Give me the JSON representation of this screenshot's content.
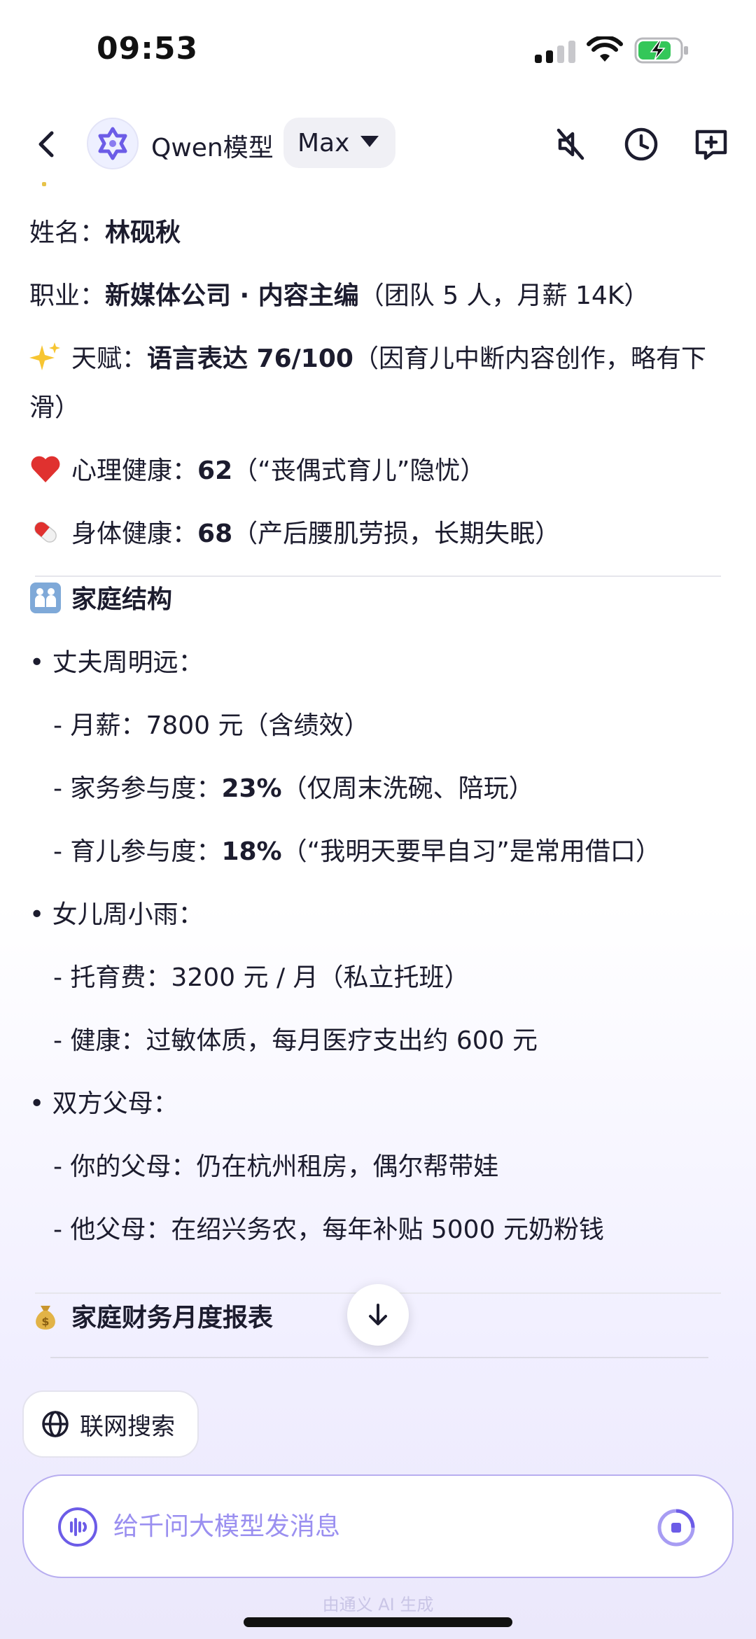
{
  "status_bar": {
    "time": "09:53",
    "battery_level": 0.75
  },
  "header": {
    "model_name": "Qwen模型",
    "model_variant": "Max"
  },
  "content": {
    "profile": [
      {
        "label": "姓名：",
        "value": "林砚秋",
        "note": ""
      },
      {
        "label": "职业：",
        "value": "新媒体公司 · 内容主编",
        "note": "（团队 5 人，月薪 14K）"
      },
      {
        "emoji": "sparkles-emoji",
        "label": "天赋：",
        "value": "语言表达 76/100",
        "note": "（因育儿中断内容创作，略有下",
        "note_cont": "滑）"
      },
      {
        "emoji": "red-heart-emoji",
        "label": "心理健康：",
        "value": "62",
        "note": "（“丧偶式育儿”隐忧）"
      },
      {
        "emoji": "pill-emoji",
        "label": "身体健康：",
        "value": "68",
        "note": "（产后腰肌劳损，长期失眠）"
      }
    ],
    "family_section": {
      "title": "家庭结构",
      "icon": "family-emoji",
      "husband": {
        "heading": "• 丈夫周明远：",
        "salary": {
          "label": "- 月薪：",
          "value": "7800 元",
          "note": "（含绩效）"
        },
        "housework": {
          "label": "- 家务参与度：",
          "value": "23%",
          "note": "（仅周末洗碗、陪玩）"
        },
        "childcare": {
          "label": "- 育儿参与度：",
          "value": "18%",
          "note": "（“我明天要早自习”是常用借口）"
        }
      },
      "daughter": {
        "heading": "• 女儿周小雨：",
        "fee": "- 托育费：3200 元 / 月（私立托班）",
        "health": "- 健康：过敏体质，每月医疗支出约 600 元"
      },
      "parents": {
        "heading": "• 双方父母：",
        "yours": "- 你的父母：仍在杭州租房，偶尔帮带娃",
        "his": "- 他父母：在绍兴务农，每年补贴 5000 元奶粉钱"
      }
    },
    "finance_section": {
      "title": "家庭财务月度报表",
      "icon": "money-bag-emoji"
    }
  },
  "toolbar": {
    "web_search_label": "联网搜索",
    "input_placeholder": "给千问大模型发消息",
    "ai_note": "由通义 AI 生成"
  },
  "colors": {
    "accent": "#6c5ce7",
    "placeholder": "#9a8ff0",
    "input_border": "#b8aef0",
    "battery_green": "#34c759"
  }
}
